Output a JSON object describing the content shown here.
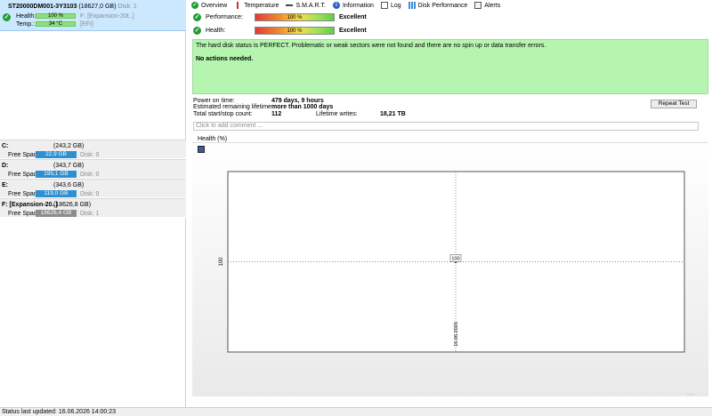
{
  "disk": {
    "name": "ST20000DM001-3Y3103",
    "size": "(18627,0 GB)",
    "disk_label": "Disk: 1",
    "health_label": "Health:",
    "health_value": "100 %",
    "volume_ref": "F: [Expansion-20t..]",
    "temp_label": "Temp.:",
    "temp_value": "34 °C",
    "efi": "[EFI]"
  },
  "volumes": [
    {
      "name": "C:",
      "size": "(243,2 GB)",
      "free_label": "Free Space",
      "free": "22,9 GB",
      "disk": "Disk: 0",
      "bar": "blue"
    },
    {
      "name": "D:",
      "size": "(343,7 GB)",
      "free_label": "Free Space",
      "free": "195,1 GB",
      "disk": "Disk: 0",
      "bar": "blue"
    },
    {
      "name": "E:",
      "size": "(343,6 GB)",
      "free_label": "Free Space",
      "free": "119,0 GB",
      "disk": "Disk: 0",
      "bar": "blue"
    },
    {
      "name": "F: [Expansion-20..]",
      "size": "(18626,8 GB)",
      "free_label": "Free Space",
      "free": "18626,4 GB",
      "disk": "Disk: 1",
      "bar": "gray"
    }
  ],
  "tabs": [
    {
      "label": "Overview",
      "icon": "check-circle-icon"
    },
    {
      "label": "Temperature",
      "icon": "thermometer-icon"
    },
    {
      "label": "S.M.A.R.T.",
      "icon": "smart-icon"
    },
    {
      "label": "Information",
      "icon": "info-icon"
    },
    {
      "label": "Log",
      "icon": "log-icon"
    },
    {
      "label": "Disk Performance",
      "icon": "performance-icon"
    },
    {
      "label": "Alerts",
      "icon": "alerts-icon"
    }
  ],
  "overview": {
    "performance_label": "Performance:",
    "performance_value": "100 %",
    "performance_verdict": "Excellent",
    "health_label": "Health:",
    "health_value": "100 %",
    "health_verdict": "Excellent",
    "status_message": "The hard disk status is PERFECT. Problematic or weak sectors were not found and there are no spin up or data transfer errors.",
    "actions": "No actions needed.",
    "power_on_label": "Power on time:",
    "power_on_value": "479 days, 9 hours",
    "lifetime_label": "Estimated remaining lifetime:",
    "lifetime_value": "more than 1000 days",
    "startstop_label": "Total start/stop count:",
    "startstop_value": "112",
    "writes_label": "Lifetime writes:",
    "writes_value": "18,21 TB",
    "repeat_test": "Repeat Test",
    "comment_placeholder": "Click to add comment ...",
    "chart_title": "Health (%)",
    "resize_grip": "....."
  },
  "chart_data": {
    "type": "line",
    "title": "Health (%)",
    "x": [
      "16.06.2026"
    ],
    "series": [
      {
        "values": [
          100
        ]
      }
    ],
    "y_tick_labels": [
      "100"
    ],
    "x_tick_labels": [
      "16.06.2026"
    ],
    "data_labels": [
      "100"
    ],
    "grid": "dotted crosshair"
  },
  "status_bar": {
    "text": "Status last updated: 16.06.2026 14:00:23"
  }
}
